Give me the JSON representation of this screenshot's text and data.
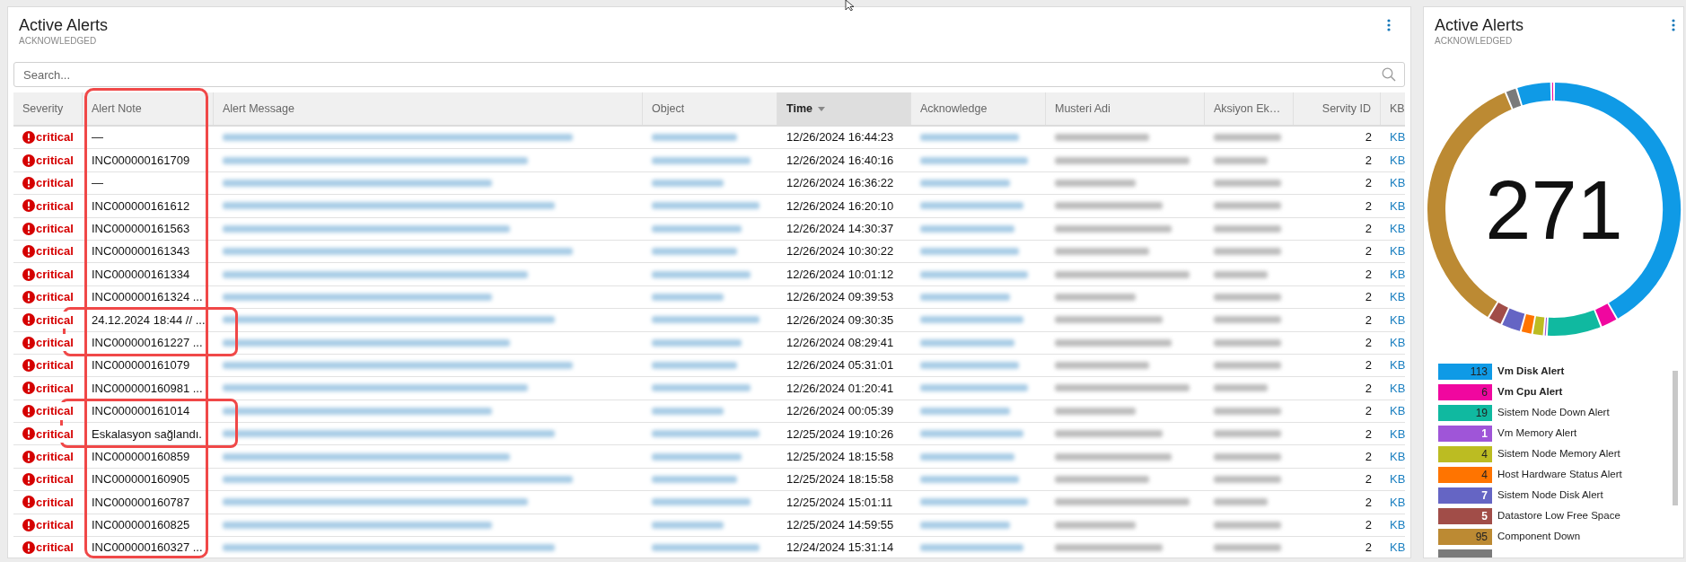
{
  "alerts_table_panel": {
    "title": "Active Alerts",
    "subtitle": "ACKNOWLEDGED",
    "search": {
      "placeholder": "Search..."
    },
    "columns": [
      {
        "label": "Severity",
        "kind": "severity",
        "sorted": false
      },
      {
        "label": "Alert Note",
        "kind": "note",
        "sorted": false
      },
      {
        "label": "Alert Message",
        "kind": "blurred-link",
        "sorted": false
      },
      {
        "label": "Object",
        "kind": "blurred-link",
        "sorted": false
      },
      {
        "label": "Time",
        "kind": "time",
        "sorted": true
      },
      {
        "label": "Acknowledge",
        "kind": "blurred-link",
        "sorted": false
      },
      {
        "label": "Musteri Adi",
        "kind": "blurred-text",
        "sorted": false
      },
      {
        "label": "Aksiyon Ek…",
        "kind": "blurred-text",
        "sorted": false
      },
      {
        "label": "Servity ID",
        "kind": "number",
        "sorted": false
      },
      {
        "label": "KB",
        "kind": "link",
        "sorted": false
      }
    ],
    "rows": [
      {
        "severity": "critical",
        "note": "—",
        "time": "12/26/2024 16:44:23",
        "servity_id": "2",
        "kb": "KB"
      },
      {
        "severity": "critical",
        "note": "INC000000161709",
        "time": "12/26/2024 16:40:16",
        "servity_id": "2",
        "kb": "KB"
      },
      {
        "severity": "critical",
        "note": "—",
        "time": "12/26/2024 16:36:22",
        "servity_id": "2",
        "kb": "KB"
      },
      {
        "severity": "critical",
        "note": "INC000000161612",
        "time": "12/26/2024 16:20:10",
        "servity_id": "2",
        "kb": "KB"
      },
      {
        "severity": "critical",
        "note": "INC000000161563",
        "time": "12/26/2024 14:30:37",
        "servity_id": "2",
        "kb": "KB"
      },
      {
        "severity": "critical",
        "note": "INC000000161343",
        "time": "12/26/2024 10:30:22",
        "servity_id": "2",
        "kb": "KB"
      },
      {
        "severity": "critical",
        "note": "INC000000161334",
        "time": "12/26/2024 10:01:12",
        "servity_id": "2",
        "kb": "KB"
      },
      {
        "severity": "critical",
        "note": "INC000000161324 ...",
        "time": "12/26/2024 09:39:53",
        "servity_id": "2",
        "kb": "KB"
      },
      {
        "severity": "critical",
        "note": "24.12.2024 18:44 // ...",
        "time": "12/26/2024 09:30:35",
        "servity_id": "2",
        "kb": "KB"
      },
      {
        "severity": "critical",
        "note": "INC000000161227 ...",
        "time": "12/26/2024 08:29:41",
        "servity_id": "2",
        "kb": "KB"
      },
      {
        "severity": "critical",
        "note": "INC000000161079",
        "time": "12/26/2024 05:31:01",
        "servity_id": "2",
        "kb": "KB"
      },
      {
        "severity": "critical",
        "note": "INC000000160981 ...",
        "time": "12/26/2024 01:20:41",
        "servity_id": "2",
        "kb": "KB"
      },
      {
        "severity": "critical",
        "note": "INC000000161014",
        "time": "12/26/2024 00:05:39",
        "servity_id": "2",
        "kb": "KB"
      },
      {
        "severity": "critical",
        "note": "Eskalasyon sağlandı.",
        "time": "12/25/2024 19:10:26",
        "servity_id": "2",
        "kb": "KB"
      },
      {
        "severity": "critical",
        "note": "INC000000160859",
        "time": "12/25/2024 18:15:58",
        "servity_id": "2",
        "kb": "KB"
      },
      {
        "severity": "critical",
        "note": "INC000000160905",
        "time": "12/25/2024 18:15:58",
        "servity_id": "2",
        "kb": "KB"
      },
      {
        "severity": "critical",
        "note": "INC000000160787",
        "time": "12/25/2024 15:01:11",
        "servity_id": "2",
        "kb": "KB"
      },
      {
        "severity": "critical",
        "note": "INC000000160825",
        "time": "12/25/2024 14:59:55",
        "servity_id": "2",
        "kb": "KB"
      },
      {
        "severity": "critical",
        "note": "INC000000160327 ...",
        "time": "12/24/2024 15:31:14",
        "servity_id": "2",
        "kb": "KB"
      }
    ]
  },
  "summary_panel": {
    "title": "Active Alerts",
    "subtitle": "ACKNOWLEDGED",
    "total": "271",
    "legend": [
      {
        "count": "113",
        "label": "Vm Disk Alert",
        "color": "#0f9ae6",
        "bold": true
      },
      {
        "count": "6",
        "label": "Vm Cpu Alert",
        "color": "#f0079f",
        "bold": true
      },
      {
        "count": "19",
        "label": "Sistem Node Down Alert",
        "color": "#10b9a0",
        "bold": false
      },
      {
        "count": "1",
        "label": "Vm Memory Alert",
        "color": "#9f55d8",
        "bold": false
      },
      {
        "count": "4",
        "label": "Sistem Node Memory Alert",
        "color": "#bcbc22",
        "bold": false
      },
      {
        "count": "4",
        "label": "Host Hardware Status Alert",
        "color": "#ff7400",
        "bold": false
      },
      {
        "count": "7",
        "label": "Sistem Node Disk Alert",
        "color": "#6565c4",
        "bold": false
      },
      {
        "count": "5",
        "label": "Datastore Low Free Space",
        "color": "#a14d48",
        "bold": false
      },
      {
        "count": "95",
        "label": "Component Down",
        "color": "#bc8a33",
        "bold": false
      }
    ]
  }
}
